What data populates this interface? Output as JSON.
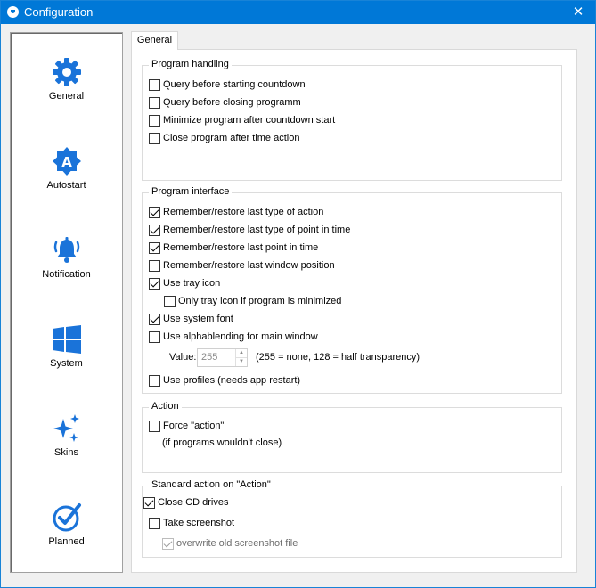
{
  "window": {
    "title": "Configuration",
    "close_glyph": "✕"
  },
  "sidebar": {
    "items": [
      {
        "label": "General",
        "icon": "gear-icon"
      },
      {
        "label": "Autostart",
        "icon": "autostart-badge-icon",
        "glyph": "A"
      },
      {
        "label": "Notification",
        "icon": "bell-icon"
      },
      {
        "label": "System",
        "icon": "windows-logo-icon"
      },
      {
        "label": "Skins",
        "icon": "sparkles-icon"
      },
      {
        "label": "Planned",
        "icon": "check-circle-icon"
      }
    ],
    "accent": "#1a73d9"
  },
  "tabs": [
    {
      "label": "General",
      "active": true
    }
  ],
  "groups": {
    "program_handling": {
      "title": "Program handling",
      "options": [
        {
          "label": "Query before starting countdown",
          "checked": false
        },
        {
          "label": "Query before closing programm",
          "checked": false
        },
        {
          "label": "Minimize program after  countdown start",
          "checked": false
        },
        {
          "label": "Close program after time action",
          "checked": false
        }
      ]
    },
    "program_interface": {
      "title": "Program interface",
      "options": [
        {
          "label": "Remember/restore last type of action",
          "checked": true
        },
        {
          "label": "Remember/restore last type of point in time",
          "checked": true
        },
        {
          "label": "Remember/restore last point in time",
          "checked": true
        },
        {
          "label": "Remember/restore last window position",
          "checked": false
        },
        {
          "label": "Use tray icon",
          "checked": true
        },
        {
          "label": "Only tray icon if program is minimized",
          "checked": false
        },
        {
          "label": "Use system font",
          "checked": true
        },
        {
          "label": "Use alphablending for main window",
          "checked": false
        },
        {
          "label": "Use profiles (needs app restart)",
          "checked": false
        }
      ],
      "alpha": {
        "label": "Value:",
        "value": "255",
        "hint": "(255 = none, 128 = half transparency)"
      }
    },
    "action": {
      "title": "Action",
      "force_label": "Force \"action\"",
      "force_checked": false,
      "note": "(if programs wouldn't close)"
    },
    "standard_action": {
      "title": "Standard action on \"Action\"",
      "options": [
        {
          "label": "Close CD drives",
          "checked": true
        },
        {
          "label": "Take screenshot",
          "checked": false
        },
        {
          "label": "overwrite old screenshot file",
          "checked": true,
          "disabled": true
        }
      ]
    }
  }
}
